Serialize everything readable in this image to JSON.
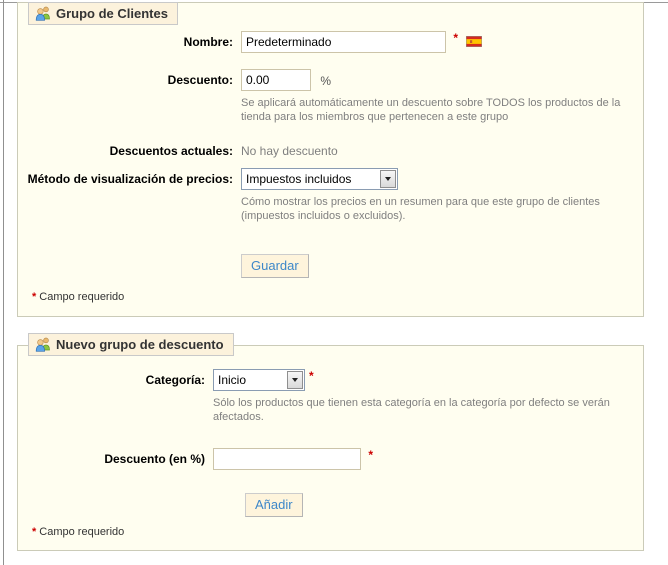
{
  "colors": {
    "fieldset_bg": "#fffef0",
    "legend_bg": "#fcf2dc",
    "button_text": "#3d87c9",
    "required": "#cc0000",
    "help_text": "#7f7f7f"
  },
  "group_form": {
    "legend": "Grupo de Clientes",
    "name_label": "Nombre:",
    "name_value": "Predeterminado",
    "required_mark": "*",
    "discount_label": "Descuento:",
    "discount_value": "0.00",
    "discount_suffix": "%",
    "discount_help": "Se aplicará automáticamente un descuento sobre TODOS los productos de la tienda para los miembros que pertenecen a este grupo",
    "current_discounts_label": "Descuentos actuales:",
    "current_discounts_value": "No hay descuento",
    "price_display_label": "Método de visualización de precios:",
    "price_display_value": "Impuestos incluidos",
    "price_display_help": "Cómo mostrar los precios en un resumen para que este grupo de clientes (impuestos incluidos o excluidos).",
    "save_button": "Guardar",
    "required_note_mark": "*",
    "required_note_text": "Campo requerido"
  },
  "new_discount_form": {
    "legend": "Nuevo grupo de descuento",
    "category_label": "Categoría:",
    "category_value": "Inicio",
    "required_mark": "*",
    "category_help": "Sólo los productos que tienen esta categoría en la categoría por defecto se verán afectados.",
    "discount_label": "Descuento (en %)",
    "discount_value": "",
    "add_button": "Añadir",
    "required_note_mark": "*",
    "required_note_text": "Campo requerido"
  }
}
